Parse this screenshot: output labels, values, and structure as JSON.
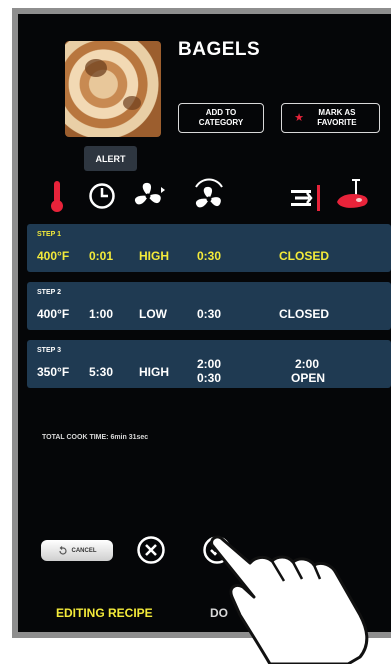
{
  "recipe": {
    "title": "BAGELS",
    "add_to_category": "ADD TO CATEGORY",
    "mark_favorite": "MARK AS FAVORITE",
    "alert": "ALERT"
  },
  "columns_icons": [
    "thermometer-icon",
    "clock-icon",
    "fan-icon",
    "fan-speed-icon",
    "damper-icon",
    "meat-probe-icon"
  ],
  "steps": [
    {
      "label": "STEP 1",
      "temp": "400°F",
      "time": "0:01",
      "fan": "HIGH",
      "duration": "0:30",
      "damper": "CLOSED"
    },
    {
      "label": "STEP 2",
      "temp": "400°F",
      "time": "1:00",
      "fan": "LOW",
      "duration": "0:30",
      "damper": "CLOSED"
    },
    {
      "label": "STEP 3",
      "temp": "350°F",
      "time": "5:30",
      "fan": "HIGH",
      "duration_top": "2:00",
      "duration_bottom": "0:30",
      "damper_top": "2:00",
      "damper_bottom": "OPEN"
    }
  ],
  "total_cook_time": "TOTAL COOK TIME: 6min 31sec",
  "footer": {
    "cancel": "CANCEL",
    "editing": "EDITING RECIPE",
    "done": "DO"
  },
  "colors": {
    "highlight": "#f3ea3a",
    "step_bg": "#1f3a52",
    "accent_red": "#e8233a"
  }
}
